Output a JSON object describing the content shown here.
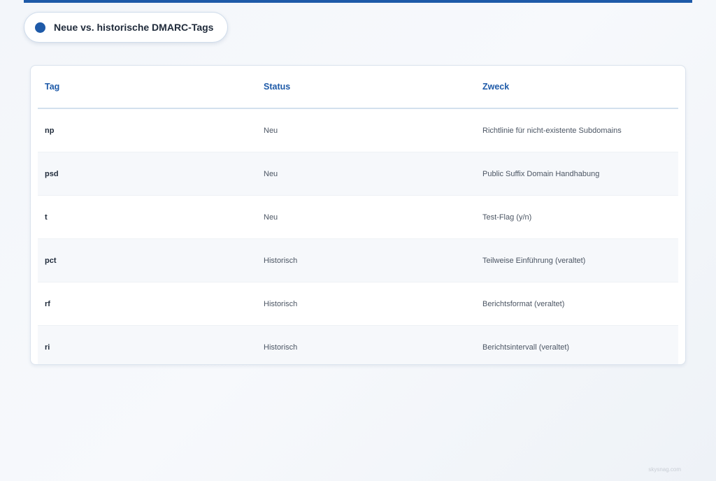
{
  "header": {
    "title": "Neue vs. historische DMARC-Tags",
    "accent_color": "#1e5aa8"
  },
  "table": {
    "columns": [
      "Tag",
      "Status",
      "Zweck"
    ],
    "rows": [
      {
        "tag": "np",
        "status": "Neu",
        "purpose": "Richtlinie für nicht-existente Subdomains"
      },
      {
        "tag": "psd",
        "status": "Neu",
        "purpose": "Public Suffix Domain Handhabung"
      },
      {
        "tag": "t",
        "status": "Neu",
        "purpose": "Test-Flag (y/n)"
      },
      {
        "tag": "pct",
        "status": "Historisch",
        "purpose": "Teilweise Einführung (veraltet)"
      },
      {
        "tag": "rf",
        "status": "Historisch",
        "purpose": "Berichtsformat (veraltet)"
      },
      {
        "tag": "ri",
        "status": "Historisch",
        "purpose": "Berichtsintervall (veraltet)"
      }
    ]
  },
  "footer": {
    "watermark": "skysnag.com"
  }
}
